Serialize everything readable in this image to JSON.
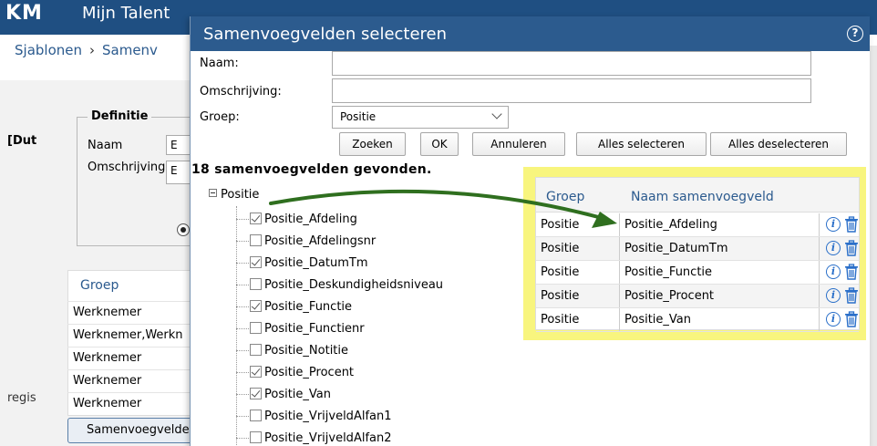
{
  "app": {
    "logo": "KM",
    "title": "Mijn Talent"
  },
  "breadcrumb": {
    "items": [
      "Sjablonen",
      "Samenv"
    ],
    "separator": "›"
  },
  "background": {
    "lang_label": "[Dut",
    "regis_label": "regis",
    "definitie": {
      "legend": "Definitie",
      "naam_label": "Naam",
      "naam_value": "E",
      "omschrijving_label": "Omschrijving",
      "omschrijving_value": "E"
    },
    "groep_table": {
      "header": "Groep",
      "rows": [
        "Werknemer",
        "Werknemer,Werkn",
        "Werknemer",
        "Werknemer",
        "Werknemer"
      ]
    },
    "button_label": "Samenvoegvelden"
  },
  "dialog": {
    "title": "Samenvoegvelden selecteren",
    "help_icon": "?",
    "form": {
      "naam_label": "Naam:",
      "naam_value": "",
      "omschrijving_label": "Omschrijving:",
      "omschrijving_value": "",
      "groep_label": "Groep:",
      "groep_value": "Positie"
    },
    "buttons": {
      "zoeken": "Zoeken",
      "ok": "OK",
      "annuleren": "Annuleren",
      "select_all": "Alles selecteren",
      "deselect_all": "Alles deselecteren"
    },
    "result_count": "18 samenvoegvelden gevonden.",
    "tree": {
      "root": "Positie",
      "items": [
        {
          "label": "Positie_Afdeling",
          "checked": true
        },
        {
          "label": "Positie_Afdelingsnr",
          "checked": false
        },
        {
          "label": "Positie_DatumTm",
          "checked": true
        },
        {
          "label": "Positie_Deskundigheidsniveau",
          "checked": false
        },
        {
          "label": "Positie_Functie",
          "checked": true
        },
        {
          "label": "Positie_Functienr",
          "checked": false
        },
        {
          "label": "Positie_Notitie",
          "checked": false
        },
        {
          "label": "Positie_Procent",
          "checked": true
        },
        {
          "label": "Positie_Van",
          "checked": true
        },
        {
          "label": "Positie_VrijveldAlfan1",
          "checked": false
        },
        {
          "label": "Positie_VrijveldAlfan2",
          "checked": false
        }
      ]
    },
    "selected_table": {
      "headers": {
        "groep": "Groep",
        "naam": "Naam samenvoegveld"
      },
      "rows": [
        {
          "groep": "Positie",
          "naam": "Positie_Afdeling"
        },
        {
          "groep": "Positie",
          "naam": "Positie_DatumTm"
        },
        {
          "groep": "Positie",
          "naam": "Positie_Functie"
        },
        {
          "groep": "Positie",
          "naam": "Positie_Procent"
        },
        {
          "groep": "Positie",
          "naam": "Positie_Van"
        }
      ],
      "info_icon": "i"
    }
  },
  "colors": {
    "header_blue": "#1f4f82",
    "dialog_title_blue": "#2c5b8e",
    "highlight_yellow": "#f8f57e",
    "arrow_green": "#2f6f1f",
    "icon_blue": "#2a6fc9"
  }
}
